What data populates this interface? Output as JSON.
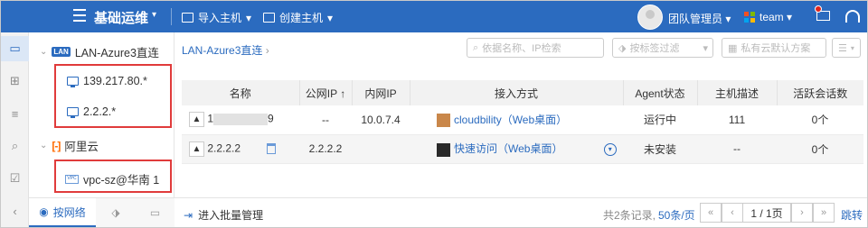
{
  "header": {
    "title": "基础运维",
    "import_host": "导入主机",
    "create_host": "创建主机",
    "team_admin": "团队管理员",
    "team": "team"
  },
  "tree": {
    "nodes": [
      {
        "label": "LAN-Azure3直连",
        "badge": "LAN"
      },
      {
        "label": "139.217.80.*"
      },
      {
        "label": "2.2.2.*"
      },
      {
        "label": "阿里云"
      },
      {
        "label": "vpc-sz@华南 1"
      }
    ],
    "tab_network": "按网络"
  },
  "main": {
    "breadcrumb": "LAN-Azure3直连",
    "search_placeholder": "依据名称、IP检索",
    "tag_filter": "按标签过滤",
    "cloud_scheme": "私有云默认方案",
    "columns": [
      "名称",
      "公网IP ↑",
      "内网IP",
      "接入方式",
      "Agent状态",
      "主机描述",
      "活跃会话数"
    ],
    "rows": [
      {
        "name_prefix": "1",
        "name_suffix": "9",
        "public_ip": "--",
        "private_ip": "10.0.7.4",
        "access": "cloudbility（Web桌面）",
        "agent": "运行中",
        "desc": "111",
        "sessions": "0个"
      },
      {
        "name": "2.2.2.2",
        "public_ip": "2.2.2.2",
        "private_ip": "",
        "access": "快速访问（Web桌面）",
        "agent": "未安装",
        "desc": "--",
        "sessions": "0个"
      }
    ]
  },
  "footer": {
    "batch": "进入批量管理",
    "records": "共2条记录,",
    "per_page": "50条/页",
    "page_info": "1 / 1页",
    "jump": "跳转"
  },
  "colors": {
    "accent": "#2b6bbf",
    "highlight": "#e03b3b"
  }
}
